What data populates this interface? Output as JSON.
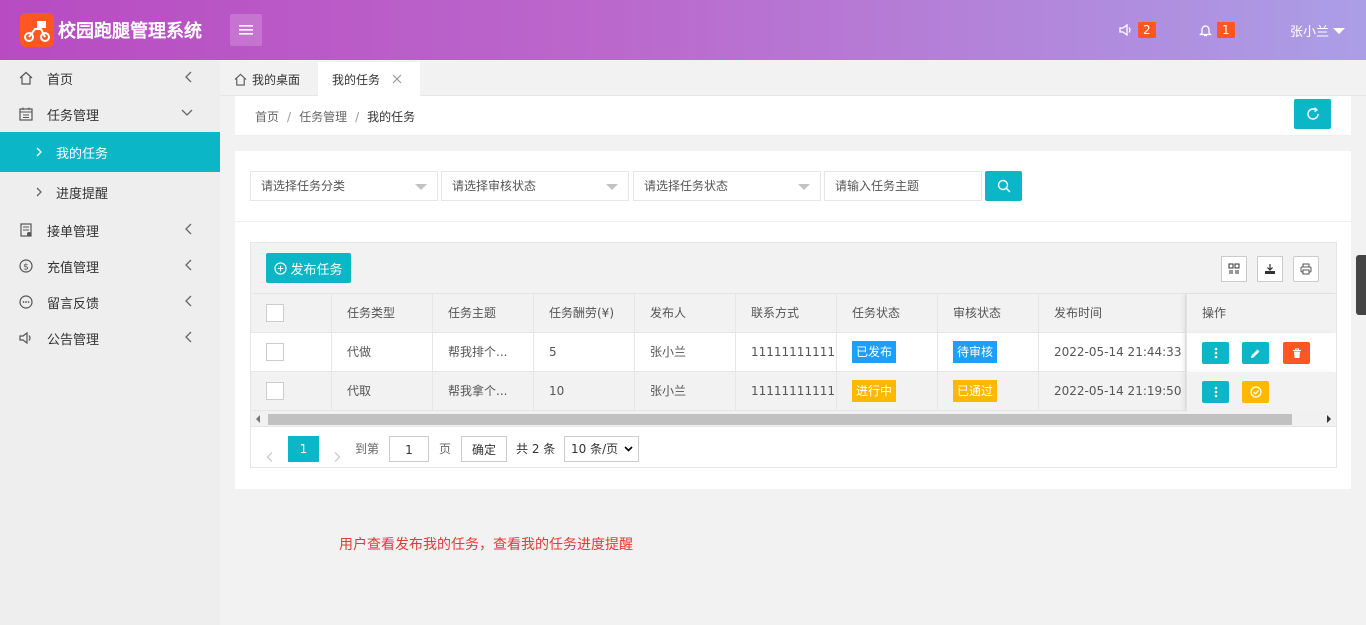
{
  "header": {
    "app_title": "校园跑腿管理系统",
    "notice_count": "2",
    "bell_count": "1",
    "user_name": "张小兰"
  },
  "sidebar": {
    "items": [
      {
        "label": "首页"
      },
      {
        "label": "任务管理"
      },
      {
        "label": "我的任务"
      },
      {
        "label": "进度提醒"
      },
      {
        "label": "接单管理"
      },
      {
        "label": "充值管理"
      },
      {
        "label": "留言反馈"
      },
      {
        "label": "公告管理"
      }
    ]
  },
  "tabs": [
    {
      "label": "我的桌面"
    },
    {
      "label": "我的任务"
    }
  ],
  "breadcrumb": [
    "首页",
    "任务管理",
    "我的任务"
  ],
  "filters": {
    "category": "请选择任务分类",
    "review": "请选择审核状态",
    "status": "请选择任务状态",
    "topic_placeholder": "请输入任务主题"
  },
  "toolbar": {
    "publish_label": "发布任务"
  },
  "table": {
    "headers": [
      "任务类型",
      "任务主题",
      "任务酬劳(¥)",
      "发布人",
      "联系方式",
      "任务状态",
      "审核状态",
      "发布时间",
      "操作"
    ],
    "rows": [
      {
        "type": "代做",
        "topic": "帮我排个...",
        "reward": "5",
        "publisher": "张小兰",
        "contact": "11111111111",
        "status": "已发布",
        "review": "待审核",
        "time": "2022-05-14 21:44:33"
      },
      {
        "type": "代取",
        "topic": "帮我拿个...",
        "reward": "10",
        "publisher": "张小兰",
        "contact": "11111111111",
        "status": "进行中",
        "review": "已通过",
        "time": "2022-05-14 21:19:50"
      }
    ]
  },
  "pager": {
    "current": "1",
    "goto_label": "到第",
    "goto_value": "1",
    "page_unit": "页",
    "ok_label": "确定",
    "total": "共 2 条",
    "page_size": "10 条/页"
  },
  "note": "用户查看发布我的任务，查看我的任务进度提醒",
  "colors": {
    "primary": "#0bb6c7",
    "danger": "#ff5722",
    "warning": "#ffb800",
    "info": "#1e9fff"
  }
}
